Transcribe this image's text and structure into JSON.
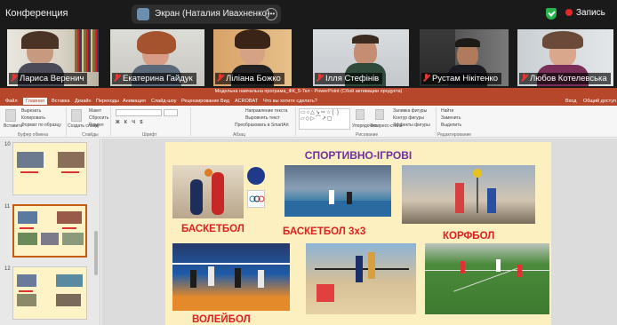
{
  "zoom": {
    "window_title": "Конференция",
    "share_label": "Экран (Наталия Ивахненко)",
    "more_icon": "ellipsis-icon",
    "security_icon": "shield-check-icon",
    "record_label": "Запись",
    "record_color": "#e02828",
    "participants": [
      {
        "name": "Лариса Веренич"
      },
      {
        "name": "Екатерина Гайдук"
      },
      {
        "name": "Ліліана Божко"
      },
      {
        "name": "Ілля Стефінів"
      },
      {
        "name": "Рустам Нікітенко"
      },
      {
        "name": "Любов Котелевська"
      }
    ]
  },
  "ppt": {
    "title": "Модельна навчальна програма_ФК_5-7кл - PowerPoint (Сбой активации продукта)",
    "accent": "#b7472a",
    "tabs": [
      "Файл",
      "Главная",
      "Вставка",
      "Дизайн",
      "Переходы",
      "Анимация",
      "Слайд-шоу",
      "Рецензирование",
      "Вид",
      "ACROBAT",
      "Что вы хотите сделать?"
    ],
    "right_tabs": [
      "Вход",
      "Общий доступ"
    ],
    "ribbon": {
      "paste": "Вставить",
      "cut": "Вырезать",
      "copy": "Копировать",
      "format_painter": "Формат по образцу",
      "clipboard_group": "Буфер обмена",
      "new_slide": "Создать слайд",
      "layout": "Макет",
      "reset": "Сбросить",
      "section": "Раздел",
      "slides_group": "Слайды",
      "font_group": "Шрифт",
      "text_direction": "Направление текста",
      "align_text": "Выровнять текст",
      "smartart": "Преобразовать в SmartArt",
      "paragraph_group": "Абзац",
      "arrange": "Упорядочить",
      "quick_styles": "Экспресс-стили",
      "drawing_group": "Рисование",
      "fill": "Заливка фигуры",
      "outline": "Контур фигуры",
      "effects": "Эффекты фигуры",
      "find": "Найти",
      "replace": "Заменить",
      "select": "Выделить",
      "editing_group": "Редактирование"
    },
    "slide_numbers": [
      "10",
      "11",
      "12"
    ],
    "slide": {
      "title": "СПОРТИВНО-ІГРОВІ",
      "labels": {
        "basketball": "БАСКЕТБОЛ",
        "basketball3x3": "БАСКЕТБОЛ 3х3",
        "korfball": "КОРФБОЛ",
        "volleyball": "ВОЛЕЙБОЛ"
      }
    }
  }
}
